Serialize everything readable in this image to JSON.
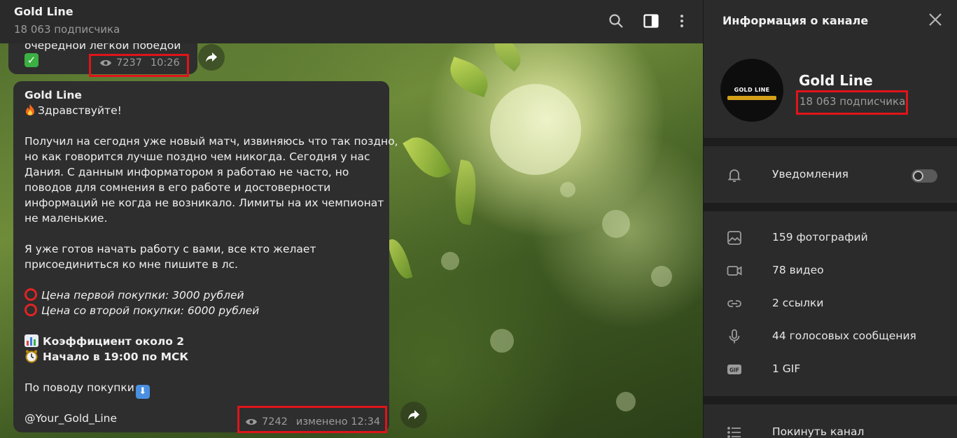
{
  "chat": {
    "title": "Gold Line",
    "subtitle": "18 063 подписчика"
  },
  "messages": [
    {
      "text_partial": "очередной легкой победой",
      "check_glyph": "✓",
      "views": "7237",
      "time": "10:26"
    },
    {
      "sender": "Gold Line",
      "greeting": "Здравствуйте!",
      "para1": [
        "Получил на сегодня уже новый матч, извиняюсь что так поздно,",
        "но как говорится лучше поздно чем никогда. Сегодня у нас",
        "Дания. С данным информатором я работаю не часто, но",
        "поводов для сомнения в его работе и достоверности",
        "информаций не когда не возникало.  Лимиты на их чемпионат",
        "не маленькие."
      ],
      "para2": [
        "Я уже готов начать работу с вами, все кто желает",
        "присоединиться ко мне пишите в лс."
      ],
      "price1": "Цена первой покупки: 3000 рублей",
      "price2": "Цена со второй покупки: 6000 рублей",
      "coef": "Коэффициент около 2",
      "start": "Начало в 19:00 по МСК",
      "purchase": "По поводу покупки",
      "down_glyph": "⬇",
      "contact": "@Your_Gold_Line",
      "views": "7242",
      "edited_time": "изменено 12:34"
    }
  ],
  "panel": {
    "title": "Информация о канале",
    "channel_name": "Gold Line",
    "subscribers": "18 063 подписчика",
    "avatar_text": "GOLD LINE",
    "notifications_label": "Уведомления",
    "notifications_on": false,
    "media": [
      {
        "icon": "photo-icon",
        "label": "159 фотографий"
      },
      {
        "icon": "video-icon",
        "label": "78 видео"
      },
      {
        "icon": "link-icon",
        "label": "2 ссылки"
      },
      {
        "icon": "microphone-icon",
        "label": "44 голосовых сообщения"
      },
      {
        "icon": "gif-icon",
        "label": "1 GIF"
      }
    ],
    "leave_label": "Покинуть канал"
  },
  "colors": {
    "highlight": "#e0141a",
    "panel_bg": "#2b2b2b",
    "bubble_bg": "#2e2e2e"
  }
}
